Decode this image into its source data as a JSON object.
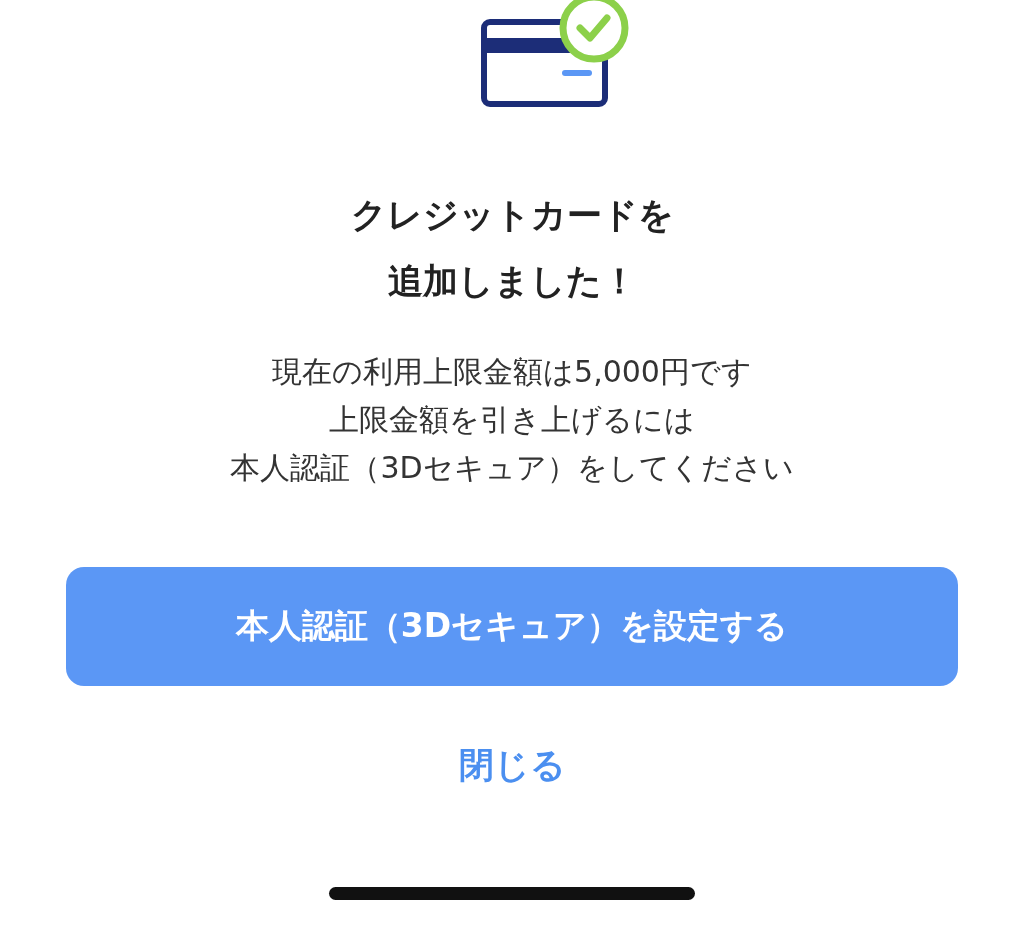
{
  "title_lines": [
    "クレジットカードを",
    "追加しました！"
  ],
  "message_lines": [
    "現在の利用上限金額は5,000円です",
    "上限金額を引き上げるには",
    "本人認証（3Dセキュア）をしてください"
  ],
  "primary_button": "本人認証（3Dセキュア）を設定する",
  "close_link": "閉じる"
}
